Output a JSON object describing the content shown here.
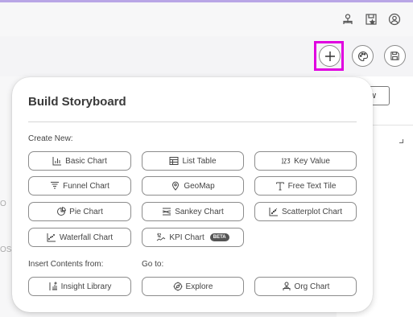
{
  "colors": {
    "accent": "#b9a6e6",
    "highlight": "#e000e0",
    "border": "#8c8c8c",
    "text": "#444444"
  },
  "topbar": {
    "icons": [
      "org-user-icon",
      "bookmark-star-icon",
      "user-account-icon"
    ]
  },
  "toolbar": {
    "icons": [
      "add-icon",
      "theme-palette-icon",
      "save-icon"
    ]
  },
  "background": {
    "button_label": "w",
    "left_text_1": "O",
    "left_text_2": "OS"
  },
  "popup": {
    "title": "Build Storyboard",
    "create_new_label": "Create New:",
    "create_new": [
      {
        "label": "Basic Chart",
        "icon": "bar-chart-icon"
      },
      {
        "label": "List Table",
        "icon": "table-icon"
      },
      {
        "label": "Key Value",
        "icon": "key-value-icon"
      },
      {
        "label": "Funnel Chart",
        "icon": "funnel-icon"
      },
      {
        "label": "GeoMap",
        "icon": "map-pin-icon"
      },
      {
        "label": "Free Text Tile",
        "icon": "text-icon"
      },
      {
        "label": "Pie Chart",
        "icon": "pie-chart-icon"
      },
      {
        "label": "Sankey Chart",
        "icon": "sankey-icon"
      },
      {
        "label": "Scatterplot Chart",
        "icon": "scatterplot-icon"
      },
      {
        "label": "Waterfall Chart",
        "icon": "waterfall-icon"
      },
      {
        "label": "KPI Chart",
        "icon": "kpi-icon",
        "badge": "BETA"
      }
    ],
    "insert_label": "Insert Contents from:",
    "insert": [
      {
        "label": "Insight Library",
        "icon": "library-icon"
      }
    ],
    "goto_label": "Go to:",
    "goto": [
      {
        "label": "Explore",
        "icon": "compass-icon"
      },
      {
        "label": "Org Chart",
        "icon": "org-chart-icon"
      }
    ]
  }
}
